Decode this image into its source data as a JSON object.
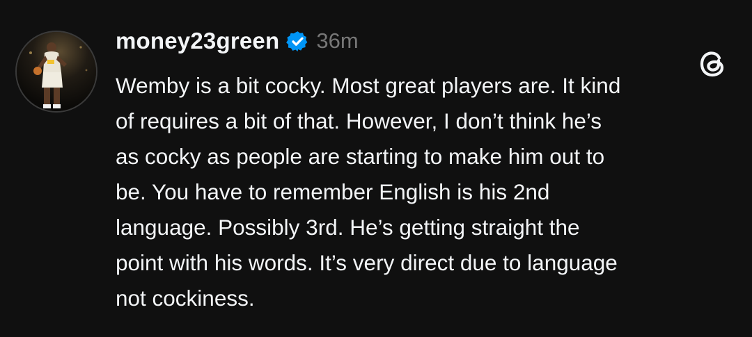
{
  "post": {
    "username": "money23green",
    "timestamp": "36m",
    "verified": true,
    "lines": [
      "Wemby is a bit cocky. Most great players are. It kind",
      "of requires a bit of that. However, I don’t think he’s",
      "as cocky as people are starting to make him out to",
      "be. You have to remember English is his 2nd",
      "language. Possibly 3rd. He’s getting straight the",
      "point with his words. It’s very direct due to language",
      "not cockiness."
    ]
  },
  "icons": {
    "verified": "verified-badge-icon",
    "app_logo": "threads-logo-icon"
  },
  "colors": {
    "background": "#101010",
    "text": "#f3f5f7",
    "muted": "#777777",
    "verified_blue": "#0095f6"
  }
}
